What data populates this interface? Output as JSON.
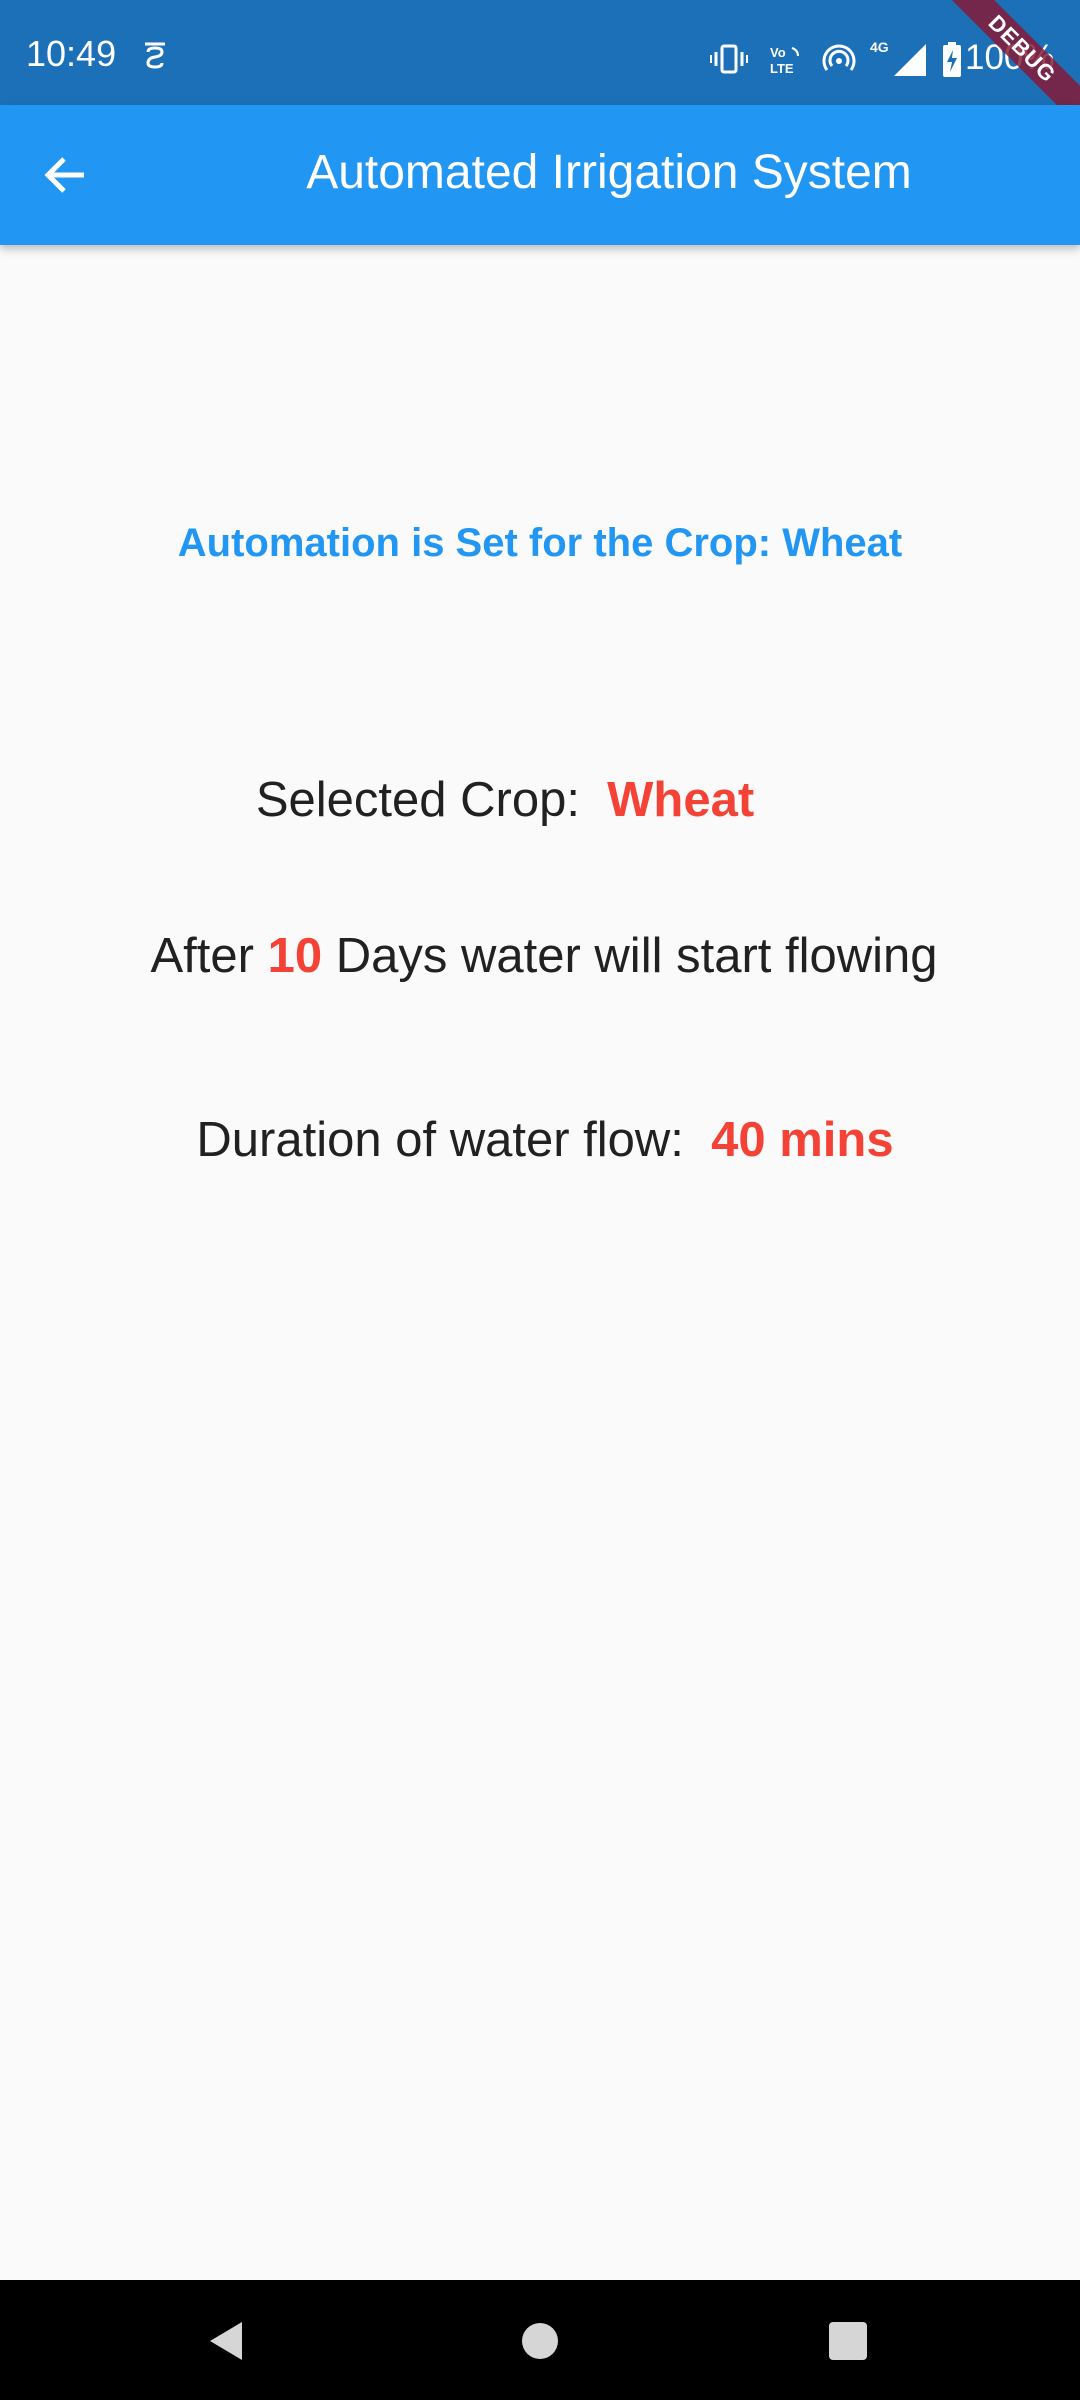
{
  "status_bar": {
    "time": "10:49",
    "battery": "100%",
    "icons": [
      "notification-icon",
      "vibrate-icon",
      "volte-icon",
      "hotspot-icon",
      "signal-4g-icon",
      "battery-charging-icon"
    ]
  },
  "debug_banner": "DEBUG",
  "app_bar": {
    "title": "Automated Irrigation System",
    "back_icon": "arrow-back-icon"
  },
  "content": {
    "status_message": "Automation is Set for the Crop: Wheat",
    "selected_crop_label": "Selected Crop:",
    "selected_crop_value": "Wheat",
    "after_prefix": "After",
    "days_value": "10",
    "after_suffix": "Days water will start flowing",
    "duration_label": "Duration of water flow:",
    "duration_value": "40 mins"
  },
  "nav_bar": {
    "icons": [
      "nav-back-icon",
      "nav-home-icon",
      "nav-recents-icon"
    ]
  },
  "colors": {
    "status_bar": "#1c70b8",
    "app_bar": "#2196f3",
    "accent_text": "#2196f3",
    "highlight": "#f44336",
    "body_text": "#212121",
    "background": "#fafafa"
  }
}
